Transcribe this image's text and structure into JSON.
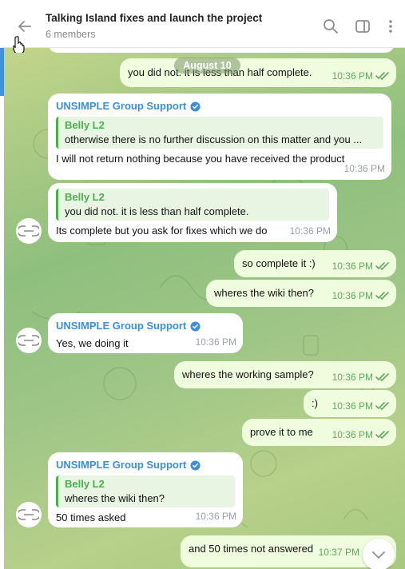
{
  "header": {
    "title": "Talking Island fixes and launch the project",
    "subtitle": "6 members",
    "icons": [
      "back-arrow-icon",
      "search-icon",
      "sidebar-toggle-icon",
      "more-vertical-icon"
    ]
  },
  "date_separator": "August 10",
  "messages": [
    {
      "id": "m1",
      "dir": "out",
      "text": "you did not. it is less than half complete.",
      "time": "10:36 PM",
      "status": "read"
    },
    {
      "id": "m2",
      "dir": "in",
      "sender": "UNSIMPLE Group Support",
      "verified": true,
      "quote": {
        "name": "Belly L2",
        "text": "otherwise there is no further discussion on this matter and you ..."
      },
      "text": "I will not return nothing because you have received the product",
      "time": "10:36 PM"
    },
    {
      "id": "m3",
      "dir": "in",
      "quote": {
        "name": "Belly L2",
        "text": "you did not. it is less than half complete."
      },
      "text": "Its complete but you ask for fixes which we do",
      "time": "10:36 PM"
    },
    {
      "id": "m4",
      "dir": "out",
      "text": "so complete it :)",
      "time": "10:36 PM",
      "status": "read"
    },
    {
      "id": "m5",
      "dir": "out",
      "text": "wheres the wiki then?",
      "time": "10:36 PM",
      "status": "read"
    },
    {
      "id": "m6",
      "dir": "in",
      "sender": "UNSIMPLE Group Support",
      "verified": true,
      "text": "Yes, we doing it",
      "time": "10:36 PM"
    },
    {
      "id": "m7",
      "dir": "out",
      "text": "wheres the working sample?",
      "time": "10:36 PM",
      "status": "read"
    },
    {
      "id": "m8",
      "dir": "out",
      "text": ":)",
      "time": "10:36 PM",
      "status": "read"
    },
    {
      "id": "m9",
      "dir": "out",
      "text": "prove it to me",
      "time": "10:36 PM",
      "status": "read"
    },
    {
      "id": "m10",
      "dir": "in",
      "sender": "UNSIMPLE Group Support",
      "verified": true,
      "quote": {
        "name": "Belly L2",
        "text": "wheres the wiki then?"
      },
      "text": "50 times asked",
      "time": "10:36 PM"
    },
    {
      "id": "m11",
      "dir": "out",
      "text": "and 50 times not answered",
      "time": "10:37 PM",
      "status": "read"
    }
  ],
  "colors": {
    "accent": "#3a8fd6",
    "quote": "#4cae4c",
    "outgoing_bubble": "#effdde",
    "incoming_bubble": "#ffffff"
  }
}
